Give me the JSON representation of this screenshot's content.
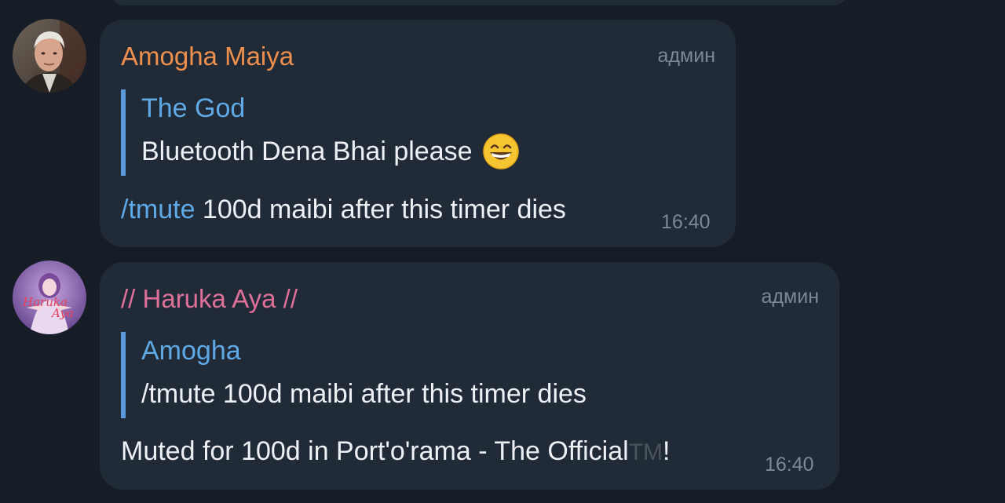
{
  "messages": [
    {
      "sender": "Amogha Maiya",
      "sender_color": "#f0904c",
      "role": "админ",
      "reply": {
        "name": "The God",
        "text": "Bluetooth Dena Bhai please",
        "emoji": "grinning-face-icon"
      },
      "text_command": "/tmute",
      "text": " 100d maibi after this timer dies",
      "time": "16:40"
    },
    {
      "sender": "// Haruka Aya //",
      "sender_color": "#e0709a",
      "role": "админ",
      "reply": {
        "name": "Amogha",
        "text": "/tmute 100d maibi after this timer dies"
      },
      "text": "Muted for 100d in Port'o'rama - The Official",
      "tm": "TM",
      "text_end": "!",
      "time": "16:40",
      "avatar_text": [
        "Haruka",
        "Aya"
      ]
    }
  ]
}
